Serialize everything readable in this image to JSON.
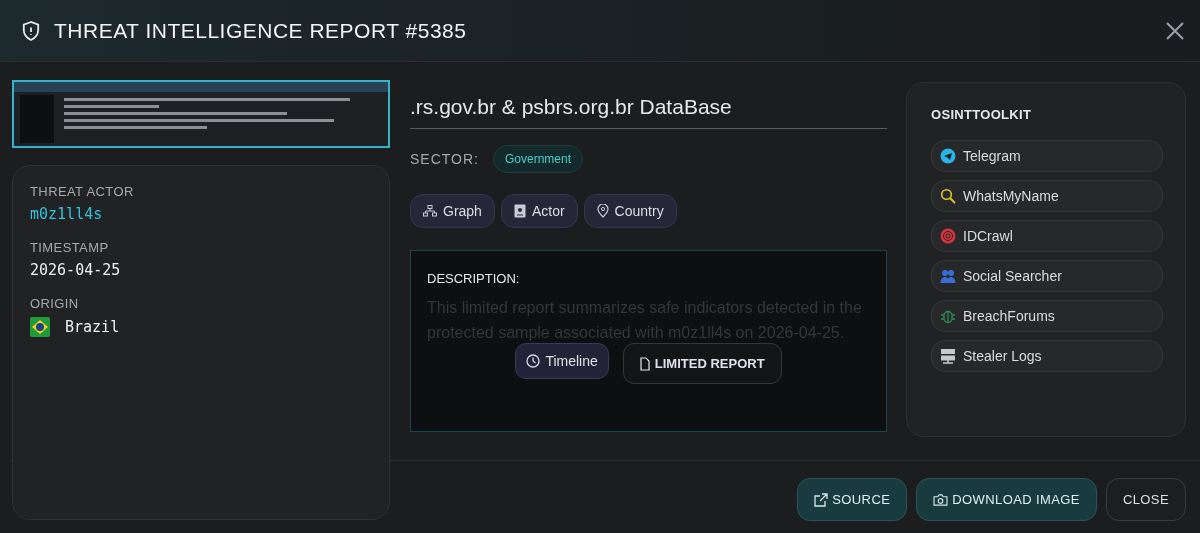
{
  "window": {
    "title": "THREAT INTELLIGENCE REPORT #5385"
  },
  "details": [
    {
      "label": "THREAT ACTOR",
      "value": "m0z1ll4s",
      "kind": "actor"
    },
    {
      "label": "TIMESTAMP",
      "value": "2026-04-25",
      "kind": "plain"
    },
    {
      "label": "ORIGIN",
      "value": "Brazil",
      "kind": "country"
    }
  ],
  "report": {
    "title": ".rs.gov.br & psbrs.org.br DataBase",
    "sector_label": "SECTOR:",
    "sector": "Government",
    "chips": [
      {
        "label": "Graph",
        "kind": "graph"
      },
      {
        "label": "Actor",
        "kind": "actor"
      },
      {
        "label": "Country",
        "kind": "country"
      }
    ],
    "description_label": "DESCRIPTION:",
    "description": "This limited report summarizes safe indicators detected in the protected sample associated with m0z1ll4s on 2026-04-25.",
    "actions": [
      {
        "label": "Timeline",
        "kind": "timeline"
      },
      {
        "label": "LIMITED REPORT",
        "kind": "report"
      }
    ]
  },
  "toolkit": {
    "title": "OSINTTOOLKIT",
    "items": [
      {
        "label": "Telegram",
        "kind": "telegram",
        "color": "#29b6e6"
      },
      {
        "label": "WhatsMyName",
        "kind": "search",
        "color": "#e6c229"
      },
      {
        "label": "IDCrawl",
        "kind": "fingerprint",
        "color": "#d6323c"
      },
      {
        "label": "Social Searcher",
        "kind": "people",
        "color": "#3a6fd8"
      },
      {
        "label": "BreachForums",
        "kind": "bug",
        "color": "#2e8b57"
      },
      {
        "label": "Stealer Logs",
        "kind": "server",
        "color": "#c8c8c8"
      }
    ]
  },
  "footer": [
    {
      "label": "SOURCE",
      "kind": "source"
    },
    {
      "label": "DOWNLOAD IMAGE",
      "kind": "download"
    },
    {
      "label": "CLOSE",
      "kind": "close"
    }
  ]
}
